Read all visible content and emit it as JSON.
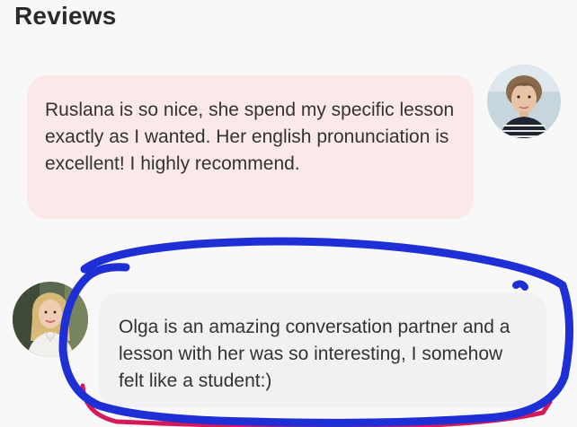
{
  "section": {
    "title": "Reviews"
  },
  "reviews": [
    {
      "text": "Ruslana is so nice, she spend my specific lesson exactly as I wanted. Her english pronunciation is excellent! I highly recommend.",
      "bubble_color": "#fbe9e9",
      "avatar": "reviewer-avatar-1"
    },
    {
      "text": "Olga is an amazing conversation partner and a lesson with her was so interesting, I somehow felt like a student:)",
      "bubble_color": "#f1f1f3",
      "avatar": "reviewer-avatar-2"
    }
  ],
  "annotation": {
    "stroke_color": "#1f2fd6",
    "underline_color": "#d6195b"
  }
}
